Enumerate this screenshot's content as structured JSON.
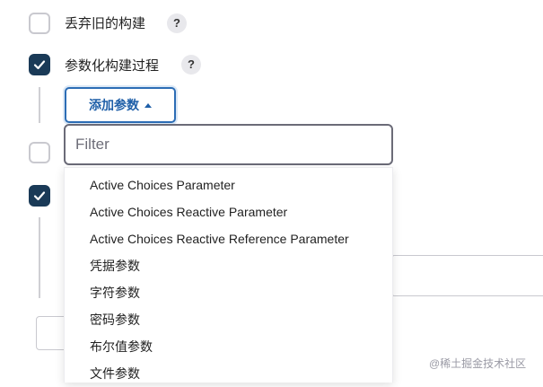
{
  "options": [
    {
      "label": "丢弃旧的构建",
      "checked": false,
      "help": "?"
    },
    {
      "label": "参数化构建过程",
      "checked": true,
      "help": "?"
    }
  ],
  "add_param_button": {
    "label": "添加参数",
    "icon": "caret-up-icon"
  },
  "filter": {
    "placeholder": "Filter",
    "value": ""
  },
  "dropdown_items": [
    "Active Choices Parameter",
    "Active Choices Reactive Parameter",
    "Active Choices Reactive Reference Parameter",
    "凭据参数",
    "字符参数",
    "密码参数",
    "布尔值参数",
    "文件参数"
  ],
  "watermark": "@稀土掘金技术社区",
  "colors": {
    "checkbox_checked": "#1a3a57",
    "button_border": "#2c6db5",
    "button_text": "#1f5fa8"
  }
}
